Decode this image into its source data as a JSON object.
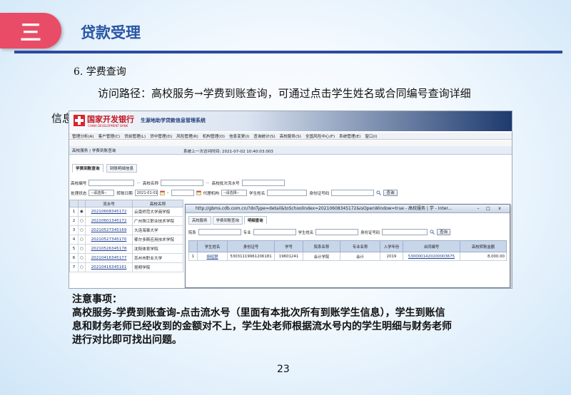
{
  "slide": {
    "badge": "三",
    "title": "贷款受理",
    "heading": "6. 学费查询",
    "para_line1": "访问路径：高校服务→学费到账查询，可通过点击学生姓名或合同编号查询详细",
    "para_line2": "信息",
    "notes_title": "注意事项：",
    "notes_line1": "高校服务-学费到账查询-点击流水号（里面有本批次所有到账学生信息），学生到账信",
    "notes_line2": "息和财务老师已经收到的金额对不上，学生处老师根据流水号内的学生明细与财务老师",
    "notes_line3": "进行对比即可找出问题。",
    "page_number": "23"
  },
  "app": {
    "bank_name": "国家开发银行",
    "bank_en": "CHINA DEVELOPMENT BANK",
    "system_name": "生源地助学贷款信息管理系统",
    "menu": [
      "管理分析(A)",
      "客户管理(C)",
      "贷前管理(L)",
      "贷中管理(D)",
      "风险管理(R)",
      "机构管理(O)",
      "信息变更(I)",
      "查询统计(S)",
      "高校服务(S)",
      "全国风险中心(F)",
      "系统管理(E)",
      "窗口(I)"
    ],
    "breadcrumb": "高校服务 | 学费到账查询",
    "last_login": "系统上一次访问时间: 2021-07-02 10:40:03.003",
    "tabs": [
      "学费到账查询",
      "到账明细信息"
    ],
    "form": {
      "school_no_label": "高校编号",
      "school_name_label": "高校名称",
      "batch_label": "高校批次流水号",
      "status_label": "处理状态",
      "status_value": "--请选择--",
      "date_label": "转账日期",
      "date_from": "2021-01-01",
      "agency_label": "代理机构",
      "agency_value": "--请选择--",
      "student_name_label": "学生姓名",
      "id_no_label": "身份证号码",
      "query_button": "查询"
    },
    "table": {
      "headers": [
        "",
        "",
        "流水号",
        "高校名称"
      ],
      "rows": [
        {
          "idx": "1",
          "serial": "20210608345172",
          "school": "云南师范大学商学院"
        },
        {
          "idx": "2",
          "serial": "20210601345172",
          "school": "广州珠江职业技术学院"
        },
        {
          "idx": "3",
          "serial": "20210527345169",
          "school": "大连海事大学"
        },
        {
          "idx": "4",
          "serial": "20210527345170",
          "school": "鄂尔多斯应用技术学院"
        },
        {
          "idx": "5",
          "serial": "20210526345178",
          "school": "沈阳体育学院"
        },
        {
          "idx": "6",
          "serial": "20210416345177",
          "school": "苏州市职业大学"
        },
        {
          "idx": "7",
          "serial": "20210416345161",
          "school": "昆明学院"
        }
      ]
    },
    "popup": {
      "title": "http://gbms.cdb.com.cn/?doType=detail&toSchoolIndex=20210608345172&isOpenWindow=true - 高校服务 | 学 - Inter...",
      "min": "–",
      "max": "□",
      "close": "x",
      "tabs": [
        "高校服务",
        "学费到账查询",
        "明细查询"
      ],
      "fields": [
        "院系",
        "专业",
        "学生姓名",
        "身份证号码"
      ],
      "query_button": "查询",
      "headers": [
        "",
        "学生姓名",
        "身份证号",
        "学号",
        "院系名称",
        "专业名称",
        "入学年份",
        "合同编号",
        "高校转账金额"
      ],
      "rows": [
        [
          "1",
          "胡绍楚",
          "53031119961206181",
          "19601241",
          "会计学院",
          "会计",
          "2019",
          "5300001420200003675",
          "8,000.00"
        ]
      ]
    }
  }
}
